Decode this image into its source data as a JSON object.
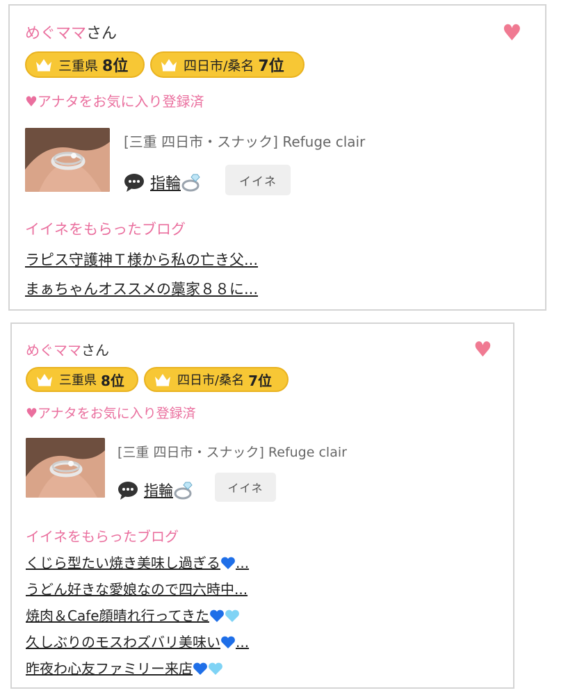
{
  "cards": [
    {
      "user": {
        "name": "めぐママ",
        "suffix": "さん"
      },
      "heart": "♥",
      "badges": [
        {
          "label": "三重県",
          "rank": "8位"
        },
        {
          "label": "四日市/桑名",
          "rank": "7位"
        }
      ],
      "favorite_status": "♥アナタをお気に入り登録済",
      "post": {
        "shop": "[三重 四日市・スナック]  Refuge clair",
        "title": "指輪",
        "like_label": "イイネ"
      },
      "liked_blogs_label": "イイネをもらったブログ",
      "blogs": [
        {
          "text": "ラピス守護神Ｔ様から私の亡き父..."
        },
        {
          "text": "まぁちゃんオススメの藁家８８に..."
        }
      ]
    },
    {
      "user": {
        "name": "めぐママ",
        "suffix": "さん"
      },
      "heart": "♥",
      "badges": [
        {
          "label": "三重県",
          "rank": "8位"
        },
        {
          "label": "四日市/桑名",
          "rank": "7位"
        }
      ],
      "favorite_status": "♥アナタをお気に入り登録済",
      "post": {
        "shop": "[三重 四日市・スナック]  Refuge clair",
        "title": "指輪",
        "like_label": "イイネ"
      },
      "liked_blogs_label": "イイネをもらったブログ",
      "blogs": [
        {
          "text": "くじら型たい焼き美味し過ぎる",
          "suffix": "..."
        },
        {
          "text": "うどん好きな愛娘なので四六時中..."
        },
        {
          "text": "焼肉＆Cafe顔晴れ行ってきた"
        },
        {
          "text": "久しぶりのモスわズバリ美味い",
          "suffix": "..."
        },
        {
          "text": "昨夜わ心友ファミリー来店"
        }
      ]
    }
  ],
  "colors": {
    "accent_pink": "#ea6f9e",
    "badge_gold": "#f7c735",
    "heart": "#f07a92",
    "blue_heart": "#1f6fe8",
    "light_blue_heart": "#7fd3f5"
  },
  "icons": [
    "crown-icon",
    "speech-bubble-icon",
    "ring-icon",
    "heart-icon",
    "blue-heart-icon",
    "light-blue-heart-icon"
  ]
}
